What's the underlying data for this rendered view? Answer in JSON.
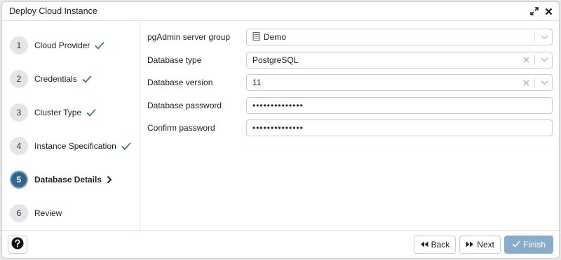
{
  "window": {
    "title": "Deploy Cloud Instance"
  },
  "steps": [
    {
      "num": "1",
      "label": "Cloud Provider",
      "status": "done"
    },
    {
      "num": "2",
      "label": "Credentials",
      "status": "done"
    },
    {
      "num": "3",
      "label": "Cluster Type",
      "status": "done"
    },
    {
      "num": "4",
      "label": "Instance Specification",
      "status": "done"
    },
    {
      "num": "5",
      "label": "Database Details",
      "status": "current"
    },
    {
      "num": "6",
      "label": "Review",
      "status": "pending"
    }
  ],
  "form": {
    "server_group": {
      "label": "pgAdmin server group",
      "value": "Demo"
    },
    "db_type": {
      "label": "Database type",
      "value": "PostgreSQL"
    },
    "db_version": {
      "label": "Database version",
      "value": "11"
    },
    "db_password": {
      "label": "Database password",
      "value": "••••••••••••••"
    },
    "confirm_password": {
      "label": "Confirm password",
      "value": "••••••••••••••"
    }
  },
  "footer": {
    "back_label": "Back",
    "next_label": "Next",
    "finish_label": "Finish"
  },
  "colors": {
    "accent": "#326690",
    "finish_bg": "#8aaccb",
    "check": "#326690"
  },
  "icons": {
    "expand": "expand-icon",
    "close": "close-icon",
    "check": "checkmark-icon",
    "current": "chevron-right-icon",
    "server_group": "server-group-icon",
    "help": "help-icon",
    "back": "rewind-icon",
    "next": "fast-forward-icon",
    "finish": "checkmark-icon"
  }
}
